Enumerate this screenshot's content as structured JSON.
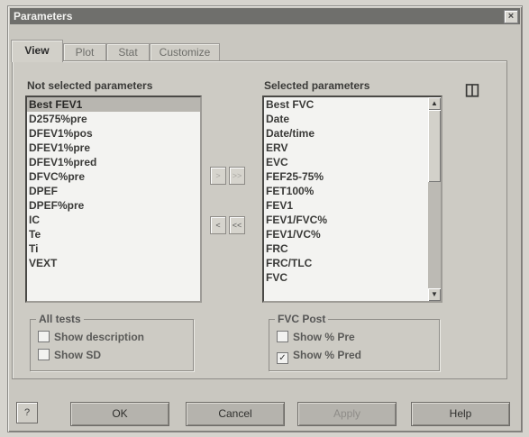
{
  "window": {
    "title": "Parameters"
  },
  "tabs": [
    {
      "label": "View"
    },
    {
      "label": "Plot"
    },
    {
      "label": "Stat"
    },
    {
      "label": "Customize"
    }
  ],
  "not_selected": {
    "label": "Not selected parameters",
    "items": [
      "Best FEV1",
      "D2575%pre",
      "DFEV1%pos",
      "DFEV1%pre",
      "DFEV1%pred",
      "DFVC%pre",
      "DPEF",
      "DPEF%pre",
      "IC",
      "Te",
      "Ti",
      "VEXT"
    ]
  },
  "selected": {
    "label": "Selected parameters",
    "items": [
      "Best FVC",
      "Date",
      "Date/time",
      "ERV",
      "EVC",
      "FEF25-75%",
      "FET100%",
      "FEV1",
      "FEV1/FVC%",
      "FEV1/VC%",
      "FRC",
      "FRC/TLC",
      "FVC"
    ]
  },
  "move_buttons": {
    "add": ">",
    "add_all": ">>",
    "remove": "<",
    "remove_all": "<<"
  },
  "all_tests": {
    "title": "All tests",
    "show_description": "Show description",
    "show_sd": "Show SD"
  },
  "fvc_post": {
    "title": "FVC Post",
    "show_pct_pre": "Show % Pre",
    "show_pct_pred": "Show % Pred",
    "show_pct_pred_checked": "✓"
  },
  "buttons": {
    "ok": "OK",
    "cancel": "Cancel",
    "apply": "Apply",
    "help": "Help"
  },
  "icons": {
    "close": "×",
    "column": "◫",
    "help_small": "?"
  }
}
